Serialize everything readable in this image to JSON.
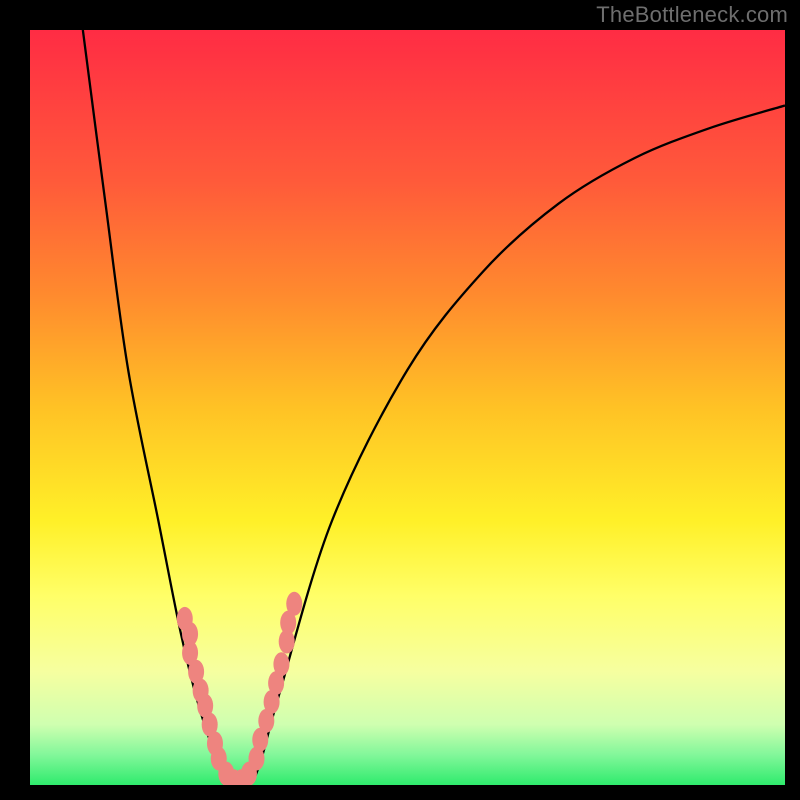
{
  "watermark_text": "TheBottleneck.com",
  "colors": {
    "frame_bg": "#000000",
    "marker_fill": "#ee847f",
    "curve_stroke": "#000000",
    "gradient_stops": [
      "#ff2c44",
      "#ff5a3a",
      "#ff8a2e",
      "#ffc225",
      "#fff028",
      "#ffff68",
      "#f6ffa0",
      "#cfffb0",
      "#82f79a",
      "#2feb6d"
    ]
  },
  "chart_data": {
    "type": "line",
    "title": "",
    "xlabel": "",
    "ylabel": "",
    "xlim": [
      0,
      100
    ],
    "ylim": [
      0,
      100
    ],
    "grid": false,
    "legend": false,
    "series": [
      {
        "name": "curve",
        "x": [
          7,
          10,
          13,
          17,
          20,
          22.5,
          25,
          27,
          29,
          30.5,
          33,
          40,
          50,
          60,
          70,
          80,
          90,
          100
        ],
        "y": [
          100,
          77,
          55,
          35,
          20,
          10,
          3,
          0,
          0,
          3,
          12,
          35,
          55,
          68,
          77,
          83,
          87,
          90
        ]
      }
    ],
    "markers": {
      "name": "cluster",
      "points": [
        {
          "x": 20.5,
          "y": 22
        },
        {
          "x": 21.2,
          "y": 20
        },
        {
          "x": 21.2,
          "y": 17.5
        },
        {
          "x": 22.0,
          "y": 15
        },
        {
          "x": 22.6,
          "y": 12.5
        },
        {
          "x": 23.2,
          "y": 10.5
        },
        {
          "x": 23.8,
          "y": 8
        },
        {
          "x": 24.5,
          "y": 5.5
        },
        {
          "x": 25.0,
          "y": 3.5
        },
        {
          "x": 26.0,
          "y": 1.5
        },
        {
          "x": 27.0,
          "y": 0.5
        },
        {
          "x": 28.0,
          "y": 0.5
        },
        {
          "x": 29.0,
          "y": 1.5
        },
        {
          "x": 30.0,
          "y": 3.5
        },
        {
          "x": 30.5,
          "y": 6
        },
        {
          "x": 31.3,
          "y": 8.5
        },
        {
          "x": 32.0,
          "y": 11
        },
        {
          "x": 32.6,
          "y": 13.5
        },
        {
          "x": 33.3,
          "y": 16
        },
        {
          "x": 34.0,
          "y": 19
        },
        {
          "x": 34.2,
          "y": 21.5
        },
        {
          "x": 35.0,
          "y": 24
        }
      ]
    }
  }
}
